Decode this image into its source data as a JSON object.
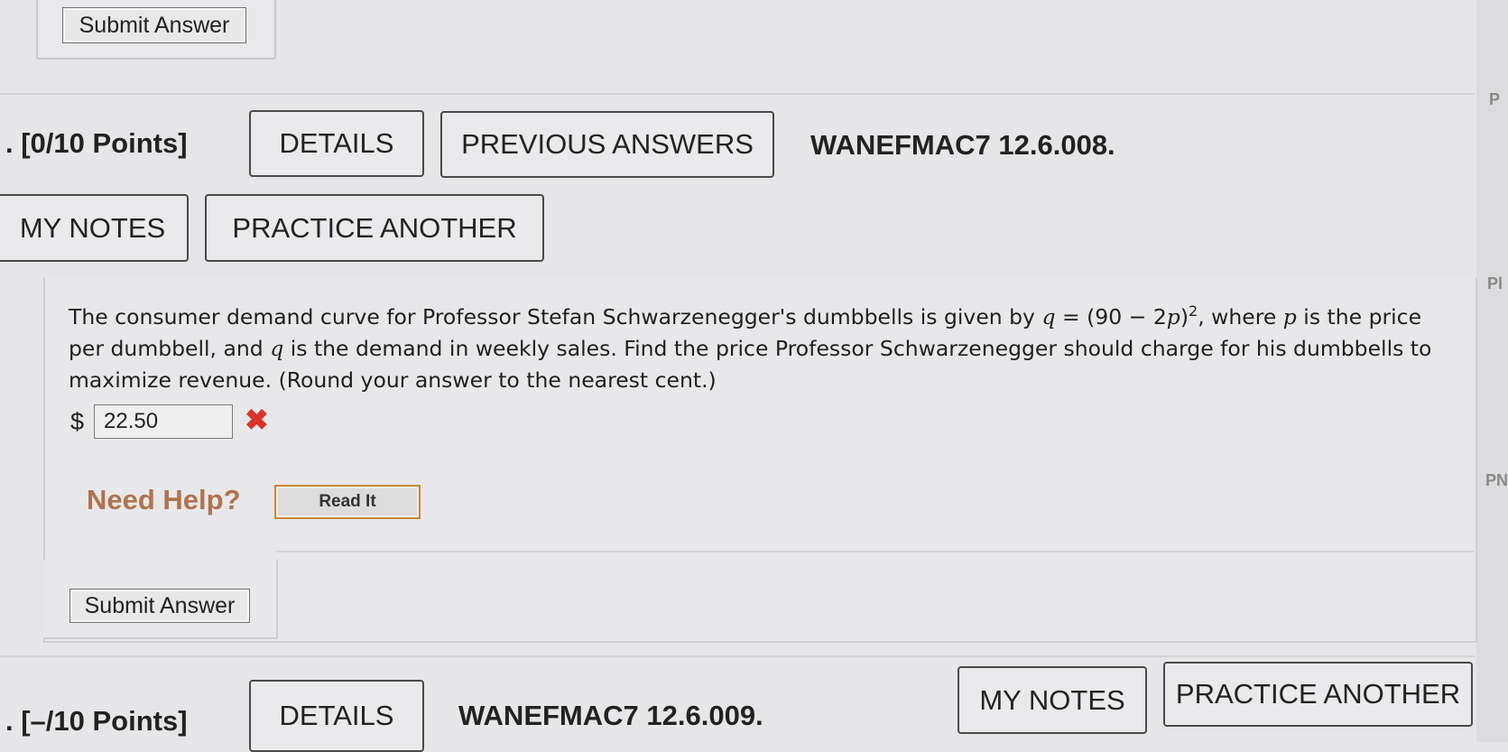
{
  "top": {
    "submit_label": "Submit Answer"
  },
  "question1": {
    "points": "[0/10 Points]",
    "details_label": "DETAILS",
    "previous_answers_label": "PREVIOUS ANSWERS",
    "code": "WANEFMAC7 12.6.008.",
    "my_notes_label": "MY NOTES",
    "practice_another_label": "PRACTICE ANOTHER",
    "text_part1": "The consumer demand curve for Professor Stefan Schwarzenegger's dumbbells is given by ",
    "var_q": "q",
    "eq_mid": " = (90 − 2",
    "var_p": "p",
    "eq_close": ")",
    "exponent": "2",
    "text_part2": ", where ",
    "var_p2": "p",
    "text_part3": " is the price per dumbbell, and ",
    "var_q2": "q",
    "text_part4": " is the demand in weekly sales. Find the price Professor Schwarzenegger should charge for his dumbbells to maximize revenue. (Round your answer to the nearest cent.)",
    "currency": "$",
    "answer_value": "22.50",
    "incorrect_mark": "✖",
    "need_help": "Need Help?",
    "read_it_label": "Read It",
    "submit_label": "Submit Answer"
  },
  "question2": {
    "points": "[–/10 Points]",
    "details_label": "DETAILS",
    "code": "WANEFMAC7 12.6.009.",
    "my_notes_label": "MY NOTES",
    "practice_another_label": "PRACTICE ANOTHER"
  },
  "side_letters": [
    "P",
    "Pl",
    "PN"
  ],
  "colors": {
    "incorrect": "#d8322b",
    "need_help": "#b0734e",
    "read_it_border": "#c88738"
  }
}
